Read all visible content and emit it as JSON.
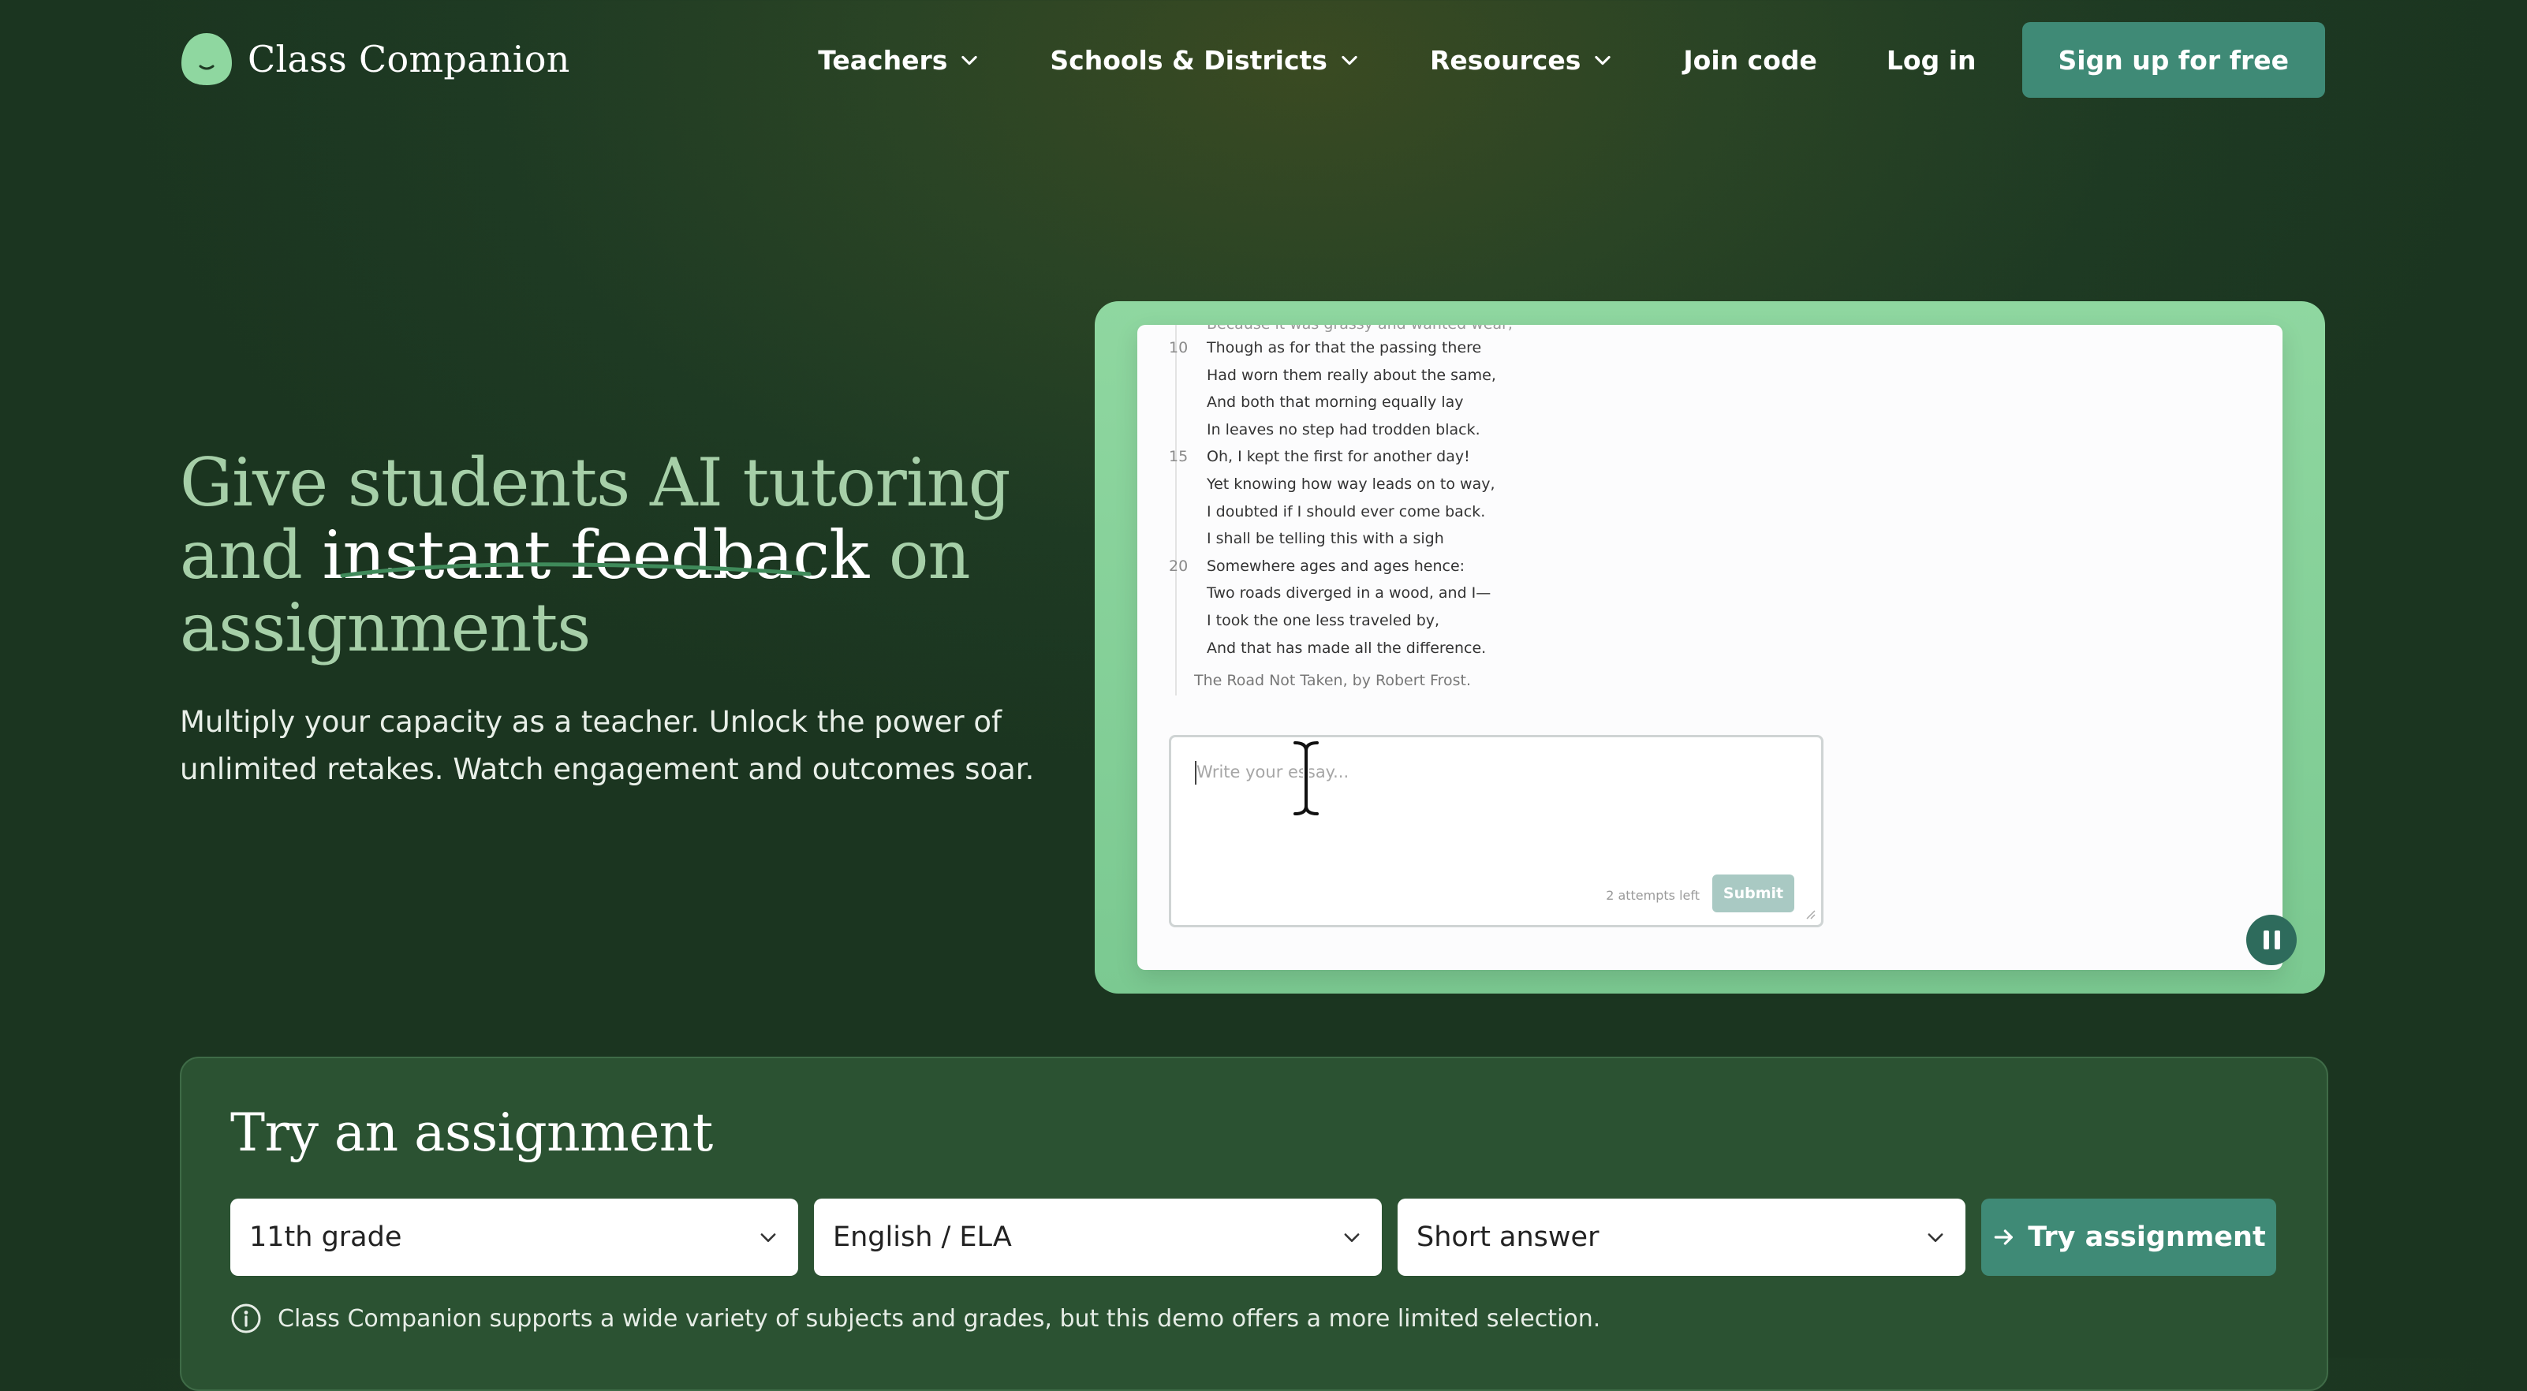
{
  "nav": {
    "brand": "Class Companion",
    "items": [
      {
        "label": "Teachers",
        "has_dropdown": true
      },
      {
        "label": "Schools & Districts",
        "has_dropdown": true
      },
      {
        "label": "Resources",
        "has_dropdown": true
      },
      {
        "label": "Join code",
        "has_dropdown": false
      },
      {
        "label": "Log in",
        "has_dropdown": false
      }
    ],
    "signup_label": "Sign up for free"
  },
  "hero": {
    "headline_part1": "Give students AI tutoring and ",
    "headline_highlight": "instant feedback",
    "headline_part2": " on assignments",
    "subtitle": "Multiply your capacity as a teacher. Unlock the power of unlimited retakes. Watch engagement and outcomes soar."
  },
  "demo": {
    "poem_partial_top": "Because it was grassy and wanted wear;",
    "poem_lines": [
      {
        "num": "10",
        "text": "Though as for that the passing there"
      },
      {
        "num": "",
        "text": "Had worn them really about the same,"
      },
      {
        "num": "",
        "text": "And both that morning equally lay"
      },
      {
        "num": "",
        "text": "In leaves no step had trodden black."
      },
      {
        "num": "15",
        "text": "Oh, I kept the first for another day!"
      },
      {
        "num": "",
        "text": "Yet knowing how way leads on to way,"
      },
      {
        "num": "",
        "text": "I doubted if I should ever come back."
      },
      {
        "num": "",
        "text": "I shall be telling this with a sigh"
      },
      {
        "num": "20",
        "text": "Somewhere ages and ages hence:"
      },
      {
        "num": "",
        "text": "Two roads diverged in a wood, and I—"
      },
      {
        "num": "",
        "text": "I took the one less traveled by,"
      },
      {
        "num": "",
        "text": "And that has made all the difference."
      }
    ],
    "attribution": "The Road Not Taken, by Robert Frost.",
    "essay_placeholder": "Write your essay...",
    "attempts_left": "2 attempts left",
    "submit_label": "Submit",
    "pause_icon": "pause-icon"
  },
  "try": {
    "title": "Try an assignment",
    "grade": "11th grade",
    "subject": "English / ELA",
    "type": "Short answer",
    "button_label": "Try assignment",
    "note": "Class Companion supports a wide variety of subjects and grades, but this demo offers a more limited selection."
  },
  "colors": {
    "accent": "#3f8a76",
    "headline_green": "#a6cfa8",
    "demo_frame": "#8fd7a0",
    "panel": "#2b5232"
  }
}
